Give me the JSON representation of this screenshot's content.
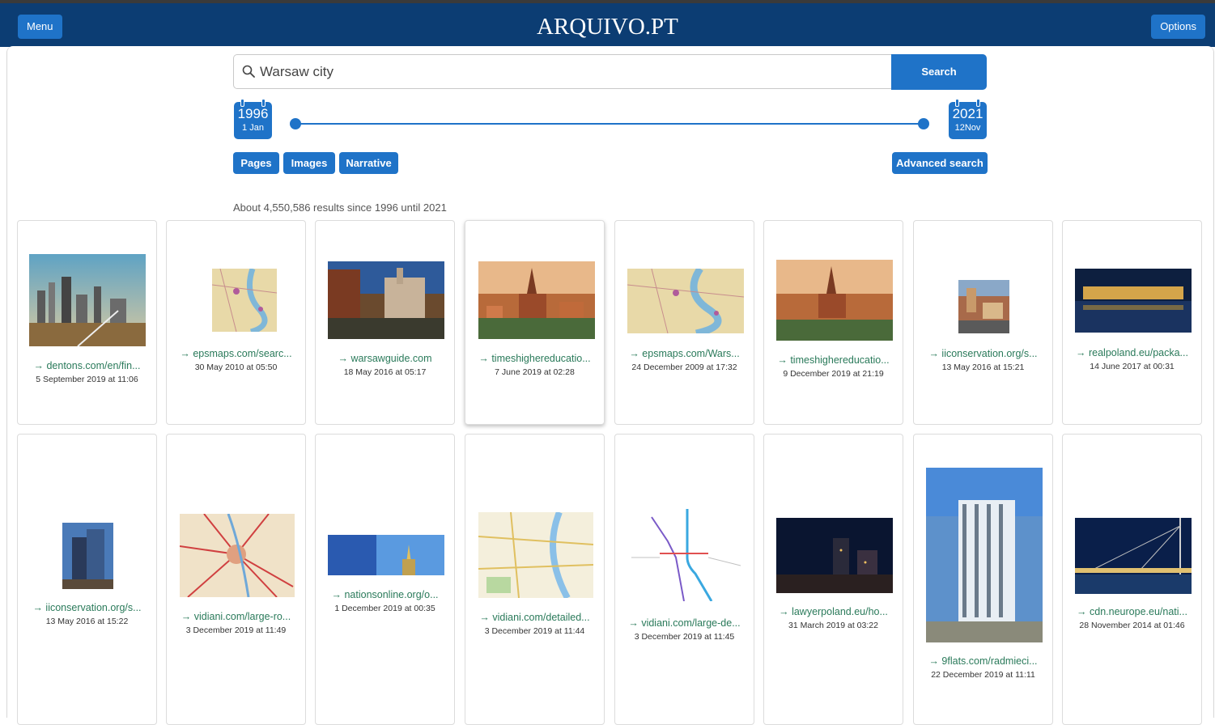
{
  "header": {
    "menu_label": "Menu",
    "logo_text": "ARQUIVO.PT",
    "options_label": "Options"
  },
  "search": {
    "query": "Warsaw city",
    "button_label": "Search",
    "start": {
      "year": "1996",
      "day": "1",
      "month": "Jan"
    },
    "end": {
      "year": "2021",
      "day": "12",
      "month": "Nov"
    }
  },
  "tabs": {
    "pages": "Pages",
    "images": "Images",
    "narrative": "Narrative",
    "advanced": "Advanced search"
  },
  "results": {
    "summary": "About 4,550,586 results since 1996 until 2021",
    "items": [
      {
        "url": "→ dentons.com/en/fin...",
        "date": "5 September 2019 at 11:06"
      },
      {
        "url": "→ epsmaps.com/searc...",
        "date": "30 May 2010 at 05:50"
      },
      {
        "url": "→ warsawguide.com",
        "date": "18 May 2016 at 05:17"
      },
      {
        "url": "→ timeshighereducatio...",
        "date": "7 June 2019 at 02:28"
      },
      {
        "url": "→ epsmaps.com/Wars...",
        "date": "24 December 2009 at 17:32"
      },
      {
        "url": "→ timeshighereducatio...",
        "date": "9 December 2019 at 21:19"
      },
      {
        "url": "→ iiconservation.org/s...",
        "date": "13 May 2016 at 15:21"
      },
      {
        "url": "→ realpoland.eu/packa...",
        "date": "14 June 2017 at 00:31"
      },
      {
        "url": "→ iiconservation.org/s...",
        "date": "13 May 2016 at 15:22"
      },
      {
        "url": "→ vidiani.com/large-ro...",
        "date": "3 December 2019 at 11:49"
      },
      {
        "url": "→ nationsonline.org/o...",
        "date": "1 December 2019 at 00:35"
      },
      {
        "url": "→ vidiani.com/detailed...",
        "date": "3 December 2019 at 11:44"
      },
      {
        "url": "→ vidiani.com/large-de...",
        "date": "3 December 2019 at 11:45"
      },
      {
        "url": "→ lawyerpoland.eu/ho...",
        "date": "31 March 2019 at 03:22"
      },
      {
        "url": "→ 9flats.com/radmieci...",
        "date": "22 December 2019 at 11:11"
      },
      {
        "url": "→ cdn.neurope.eu/nati...",
        "date": "28 November 2014 at 01:46"
      }
    ]
  },
  "colors": {
    "header_bg": "#0c3d73",
    "accent": "#1f73c8",
    "link": "#2a7a5a"
  }
}
